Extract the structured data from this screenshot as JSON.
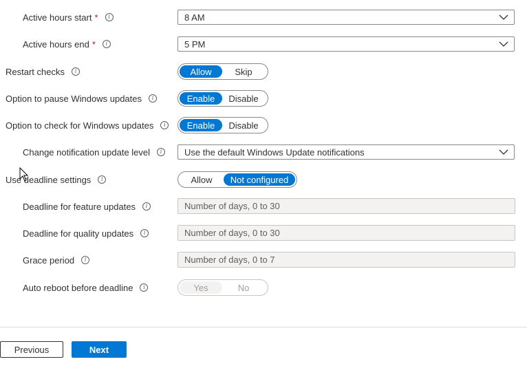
{
  "info_glyph": "i",
  "form": {
    "active_hours_start": {
      "label": "Active hours start",
      "required_mark": "*",
      "value": "8 AM"
    },
    "active_hours_end": {
      "label": "Active hours end",
      "required_mark": "*",
      "value": "5 PM"
    },
    "restart_checks": {
      "label": "Restart checks",
      "options": [
        "Allow",
        "Skip"
      ],
      "selected": "Allow"
    },
    "pause_updates": {
      "label": "Option to pause Windows updates",
      "options": [
        "Enable",
        "Disable"
      ],
      "selected": "Enable"
    },
    "check_updates": {
      "label": "Option to check for Windows updates",
      "options": [
        "Enable",
        "Disable"
      ],
      "selected": "Enable"
    },
    "notification_level": {
      "label": "Change notification update level",
      "value": "Use the default Windows Update notifications"
    },
    "deadline_settings": {
      "label": "Use deadline settings",
      "options": [
        "Allow",
        "Not configured"
      ],
      "selected": "Not configured"
    },
    "deadline_feature": {
      "label": "Deadline for feature updates",
      "placeholder": "Number of days, 0 to 30"
    },
    "deadline_quality": {
      "label": "Deadline for quality updates",
      "placeholder": "Number of days, 0 to 30"
    },
    "grace_period": {
      "label": "Grace period",
      "placeholder": "Number of days, 0 to 7"
    },
    "auto_reboot": {
      "label": "Auto reboot before deadline",
      "options": [
        "Yes",
        "No"
      ],
      "selected": "Yes",
      "disabled": true
    }
  },
  "footer": {
    "previous_label": "Previous",
    "next_label": "Next"
  },
  "colors": {
    "accent": "#0078d4",
    "required": "#a4262c",
    "disabled_fill": "#f3f2f1"
  },
  "icons": [
    "info-icon",
    "chevron-down-icon",
    "mouse-cursor-icon"
  ]
}
